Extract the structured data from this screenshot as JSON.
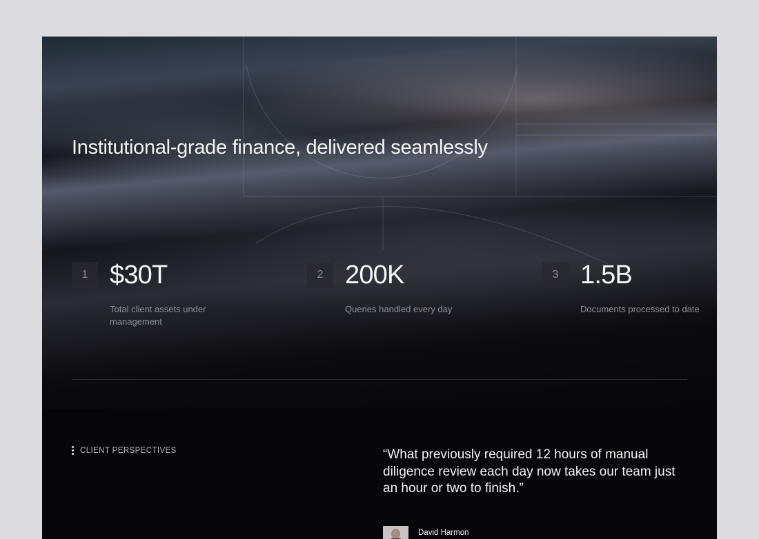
{
  "hero": {
    "title": "Institutional-grade finance, delivered seamlessly"
  },
  "stats": [
    {
      "index": "1",
      "value": "$30T",
      "label": "Total client assets under management"
    },
    {
      "index": "2",
      "value": "200K",
      "label": "Queries handled every day"
    },
    {
      "index": "3",
      "value": "1.5B",
      "label": "Documents processed to date"
    }
  ],
  "testimonial": {
    "eyebrow": "CLIENT PERSPECTIVES",
    "quote": "“What previously required 12 hours of manual diligence review each day now takes our team just an hour or two to finish.”",
    "author": "David Harmon"
  },
  "icons": {
    "eyebrow": "dots-vertical-icon",
    "avatar": "person-avatar"
  }
}
